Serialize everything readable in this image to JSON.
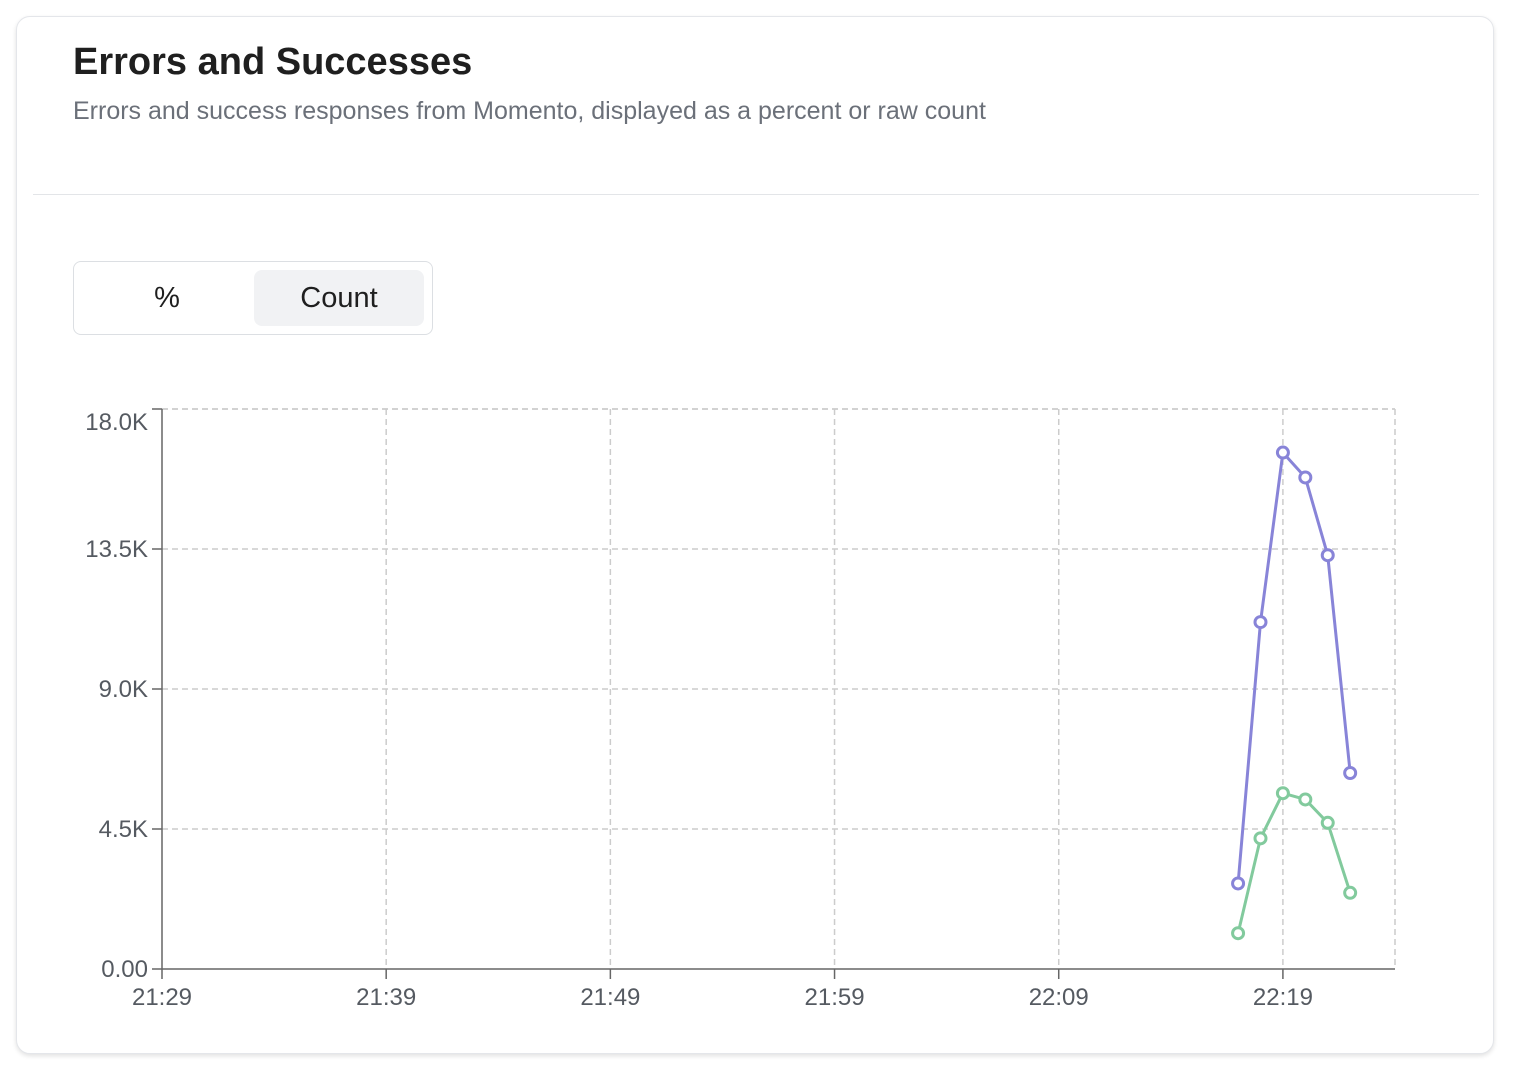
{
  "header": {
    "title": "Errors and Successes",
    "subtitle": "Errors and success responses from Momento, displayed as a percent or raw count"
  },
  "toggle": {
    "options": [
      "%",
      "Count"
    ],
    "selected": "Count"
  },
  "colors": {
    "success": "#8884d8",
    "error": "#82ca9d",
    "grid": "#cccccc",
    "axis": "#666666"
  },
  "chart_data": {
    "type": "line",
    "x_ticks": [
      "21:29",
      "21:39",
      "21:49",
      "21:59",
      "22:09",
      "22:19"
    ],
    "x_start": "21:29",
    "x_end": "22:24",
    "y_ticks": [
      "0.00",
      "4.5K",
      "9.0K",
      "13.5K",
      "18.0K"
    ],
    "ylim": [
      0,
      18000
    ],
    "grid": true,
    "series": [
      {
        "color": "#8884d8",
        "points": [
          {
            "x": "22:17",
            "y": 2750
          },
          {
            "x": "22:18",
            "y": 11150
          },
          {
            "x": "22:19",
            "y": 16600
          },
          {
            "x": "22:20",
            "y": 15800
          },
          {
            "x": "22:21",
            "y": 13300
          },
          {
            "x": "22:22",
            "y": 6300
          }
        ]
      },
      {
        "color": "#82ca9d",
        "points": [
          {
            "x": "22:17",
            "y": 1150
          },
          {
            "x": "22:18",
            "y": 4200
          },
          {
            "x": "22:19",
            "y": 5650
          },
          {
            "x": "22:20",
            "y": 5450
          },
          {
            "x": "22:21",
            "y": 4700
          },
          {
            "x": "22:22",
            "y": 2450
          }
        ]
      }
    ]
  }
}
